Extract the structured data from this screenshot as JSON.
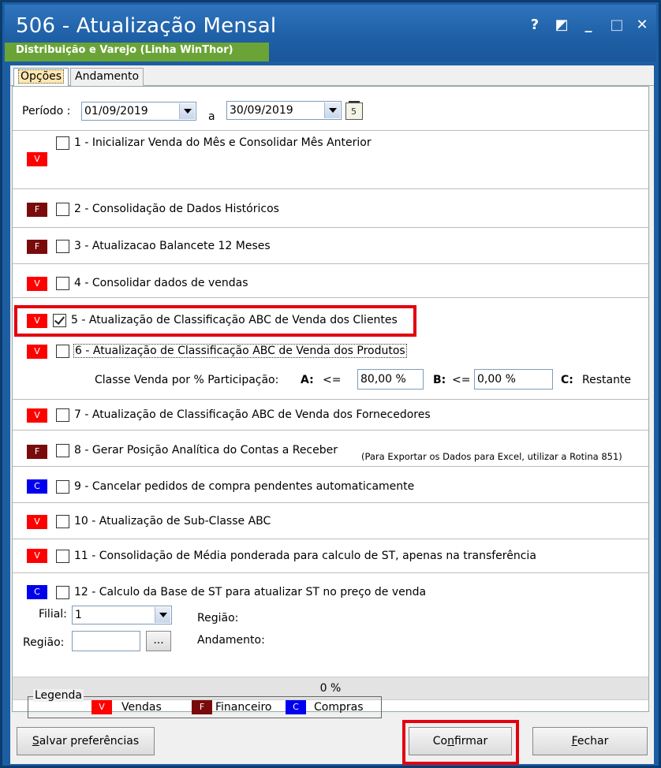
{
  "window": {
    "title": "506 - Atualização Mensal",
    "subtitle": "Distribuição e Varejo (Linha WinThor)",
    "controls": [
      "?",
      "◩",
      "_",
      "□",
      "✕"
    ]
  },
  "tabs": [
    {
      "label": "Opções",
      "active": true
    },
    {
      "label": "Andamento",
      "active": false
    }
  ],
  "periodo": {
    "label": "Período :",
    "start": "01/09/2019",
    "sep": "a",
    "end": "30/09/2019"
  },
  "options": [
    {
      "num": "1",
      "text": "1 - Inicializar Venda do Mês e Consolidar Mês Anterior",
      "badge": "V",
      "checked": false
    },
    {
      "num": "2",
      "text": "2 - Consolidação de Dados Históricos",
      "badge": "F",
      "checked": false
    },
    {
      "num": "3",
      "text": "3 - Atualizacao Balancete 12 Meses",
      "badge": "F",
      "checked": false
    },
    {
      "num": "4",
      "text": "4 - Consolidar dados de vendas",
      "badge": "V",
      "checked": false
    },
    {
      "num": "5",
      "text": "5 - Atualização de Classificação ABC de Venda dos Clientes",
      "badge": "V",
      "checked": true
    },
    {
      "num": "6",
      "text": "6 - Atualização de Classificação ABC de Venda dos Produtos",
      "badge": "V",
      "checked": false
    },
    {
      "num": "7",
      "text": "7 - Atualização de Classificação ABC de Venda dos Fornecedores",
      "badge": "V",
      "checked": false
    },
    {
      "num": "8",
      "text": "8 - Gerar  Posição Analítica do Contas a Receber",
      "badge": "F",
      "checked": false
    },
    {
      "num": "9",
      "text": "9 - Cancelar pedidos de compra pendentes automaticamente",
      "badge": "C",
      "checked": false
    },
    {
      "num": "10",
      "text": "10 - Atualização de Sub-Classe ABC",
      "badge": "V",
      "checked": false
    },
    {
      "num": "11",
      "text": "11 - Consolidação de Média ponderada para calculo de ST, apenas na transferência",
      "badge": "V",
      "checked": false
    },
    {
      "num": "12",
      "text": "12 - Calculo da Base de ST para atualizar ST no preço de venda",
      "badge": "C",
      "checked": false
    }
  ],
  "opt6": {
    "classe_label": "Classe Venda por % Participação:",
    "a_label": "A:",
    "a_op": "<=",
    "a_value": "80,00 %",
    "b_label": "B:",
    "b_op": "<=",
    "b_value": "0,00 %",
    "c_label": "C:",
    "c_value": "Restante"
  },
  "opt8_note": "(Para Exportar os Dados para Excel, utilizar a Rotina 851)",
  "opt12": {
    "filial_label": "Filial:",
    "filial_value": "1",
    "regiao_label": "Região:",
    "regiao_value": "",
    "dots": "...",
    "regiao_right_label": "Região:",
    "andamento_label": "Andamento:"
  },
  "progress": {
    "text": "0 %",
    "value": 0
  },
  "legend": {
    "title": "Legenda",
    "items": [
      {
        "badge": "V",
        "label": "Vendas"
      },
      {
        "badge": "F",
        "label": "Financeiro"
      },
      {
        "badge": "C",
        "label": "Compras"
      }
    ]
  },
  "buttons": {
    "salvar": {
      "pre": "",
      "u": "S",
      "post": "alvar preferências"
    },
    "confirmar": {
      "pre": "Co",
      "u": "n",
      "post": "firmar"
    },
    "fechar": {
      "pre": "",
      "u": "F",
      "post": "echar"
    }
  },
  "colors": {
    "badge_v": "#ff0000",
    "badge_f": "#7a0b0b",
    "badge_c": "#0000ee",
    "title_bar": "#1e5fa5",
    "highlight": "#e3000f"
  }
}
